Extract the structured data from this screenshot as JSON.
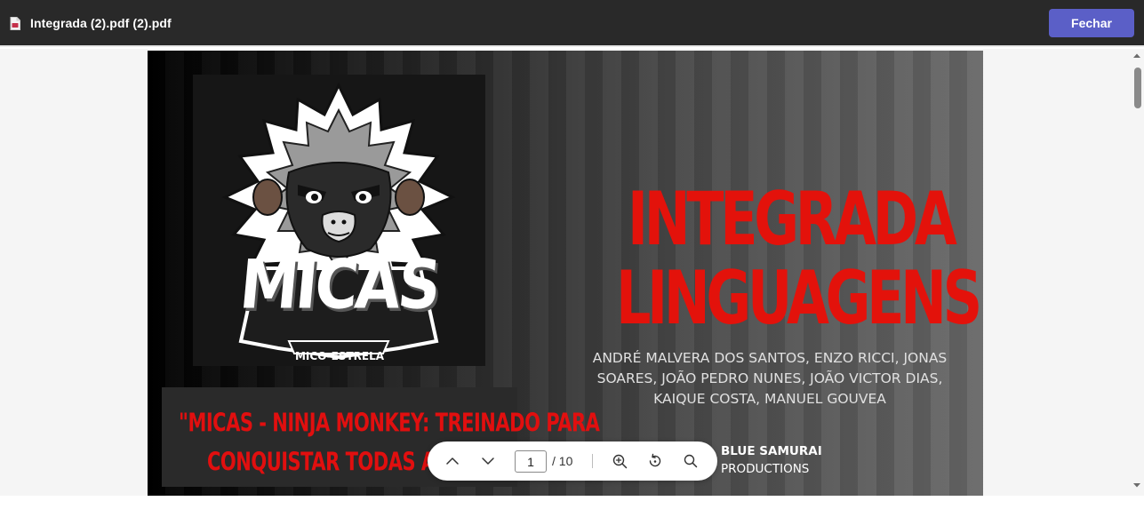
{
  "header": {
    "file_title": "Integrada (2).pdf (2).pdf",
    "file_icon": "pdf-file-icon",
    "close_label": "Fechar",
    "accent_color": "#5b5fc7"
  },
  "document": {
    "logo": {
      "name": "MICAS",
      "tagline": "MICO-ESTRELA",
      "icon": "monkey-mascot-icon"
    },
    "slogan": {
      "line1": "\"MICAS - NINJA MONKEY: TREINADO PARA",
      "line2": "CONQUISTAR TODAS AS FR"
    },
    "title": {
      "line1": "INTEGRADA",
      "line2": "LINGUAGENS",
      "color": "#e3120b"
    },
    "authors": {
      "line1": "ANDRÉ MALVERA DOS SANTOS, ENZO RICCI, JONAS",
      "line2": "SOARES, JOÃO PEDRO NUNES, JOÃO VICTOR DIAS,",
      "line3": "KAIQUE COSTA, MANUEL GOUVEA"
    },
    "brand": {
      "line1": "BLUE SAMURAI",
      "line2": "PRODUCTIONS"
    }
  },
  "toolbar": {
    "prev_icon": "chevron-up-icon",
    "next_icon": "chevron-down-icon",
    "current_page": "1",
    "total_pages": "/ 10",
    "zoom_in_icon": "zoom-in-icon",
    "rotate_icon": "rotate-icon",
    "search_icon": "search-icon"
  }
}
